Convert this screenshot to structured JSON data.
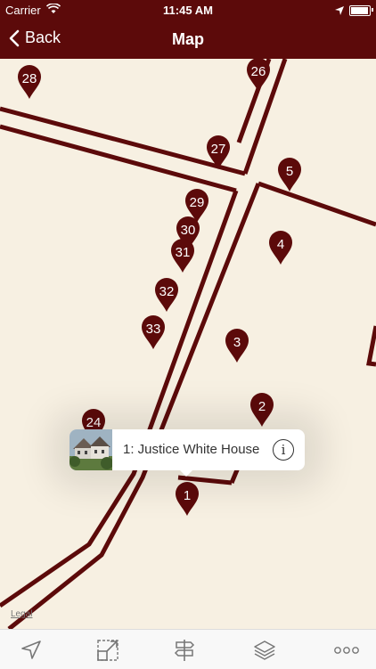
{
  "status_bar": {
    "carrier": "Carrier",
    "time": "11:45 AM"
  },
  "nav": {
    "back_label": "Back",
    "title": "Map"
  },
  "map": {
    "pins": [
      "28",
      "26",
      "27",
      "5",
      "29",
      "4",
      "30",
      "31",
      "32",
      "33",
      "3",
      "2",
      "24",
      "1"
    ],
    "callout": {
      "title": "1: Justice White House"
    },
    "legal": "Legal",
    "colors": {
      "road": "#5c0a0a",
      "background": "#f7f0e2",
      "pin": "#5c0a0a"
    }
  },
  "toolbar": {
    "icons": [
      "location-arrow-icon",
      "resize-icon",
      "signpost-icon",
      "layers-icon",
      "more-icon"
    ]
  }
}
